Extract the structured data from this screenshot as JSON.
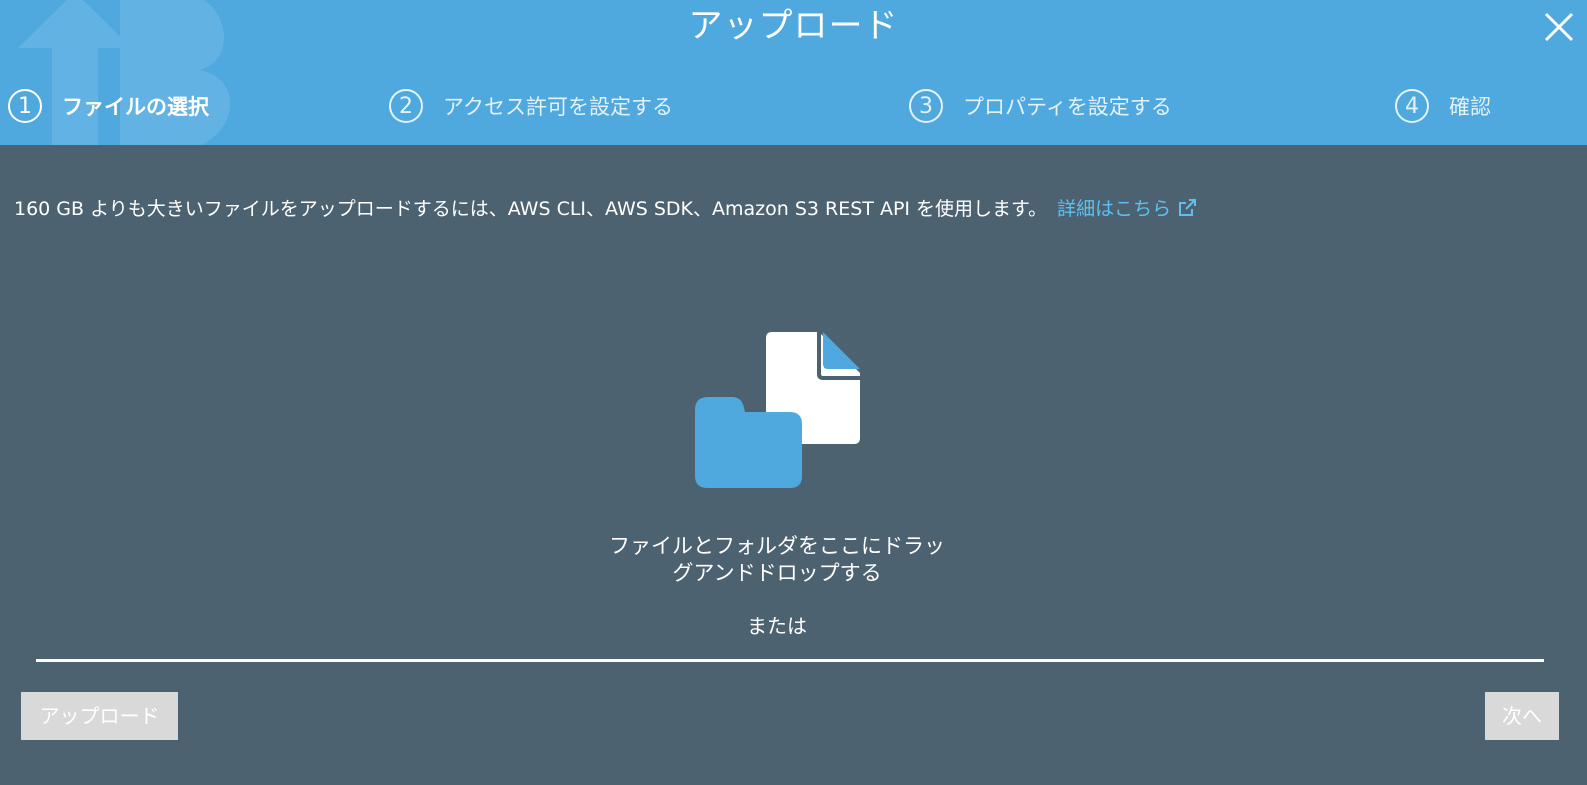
{
  "dialog": {
    "title": "アップロード"
  },
  "steps": [
    {
      "number": "1",
      "label": "ファイルの選択"
    },
    {
      "number": "2",
      "label": "アクセス許可を設定する"
    },
    {
      "number": "3",
      "label": "プロパティを設定する"
    },
    {
      "number": "4",
      "label": "確認"
    }
  ],
  "active_step": 1,
  "info": {
    "text": "160 GB よりも大きいファイルをアップロードするには、AWS CLI、AWS SDK、Amazon S3 REST API を使用します。",
    "link_label": "詳細はこちら"
  },
  "dropzone": {
    "line1": "ファイルとフォルダをここにドラッ",
    "line2": "グアンドドロップする",
    "or_label": "または"
  },
  "buttons": {
    "upload_label": "アップロード",
    "next_label": "次へ"
  },
  "colors": {
    "header": "#4fa8de",
    "background": "#4d6270",
    "link": "#5dc0f0",
    "button_disabled": "#d9d9d9"
  }
}
